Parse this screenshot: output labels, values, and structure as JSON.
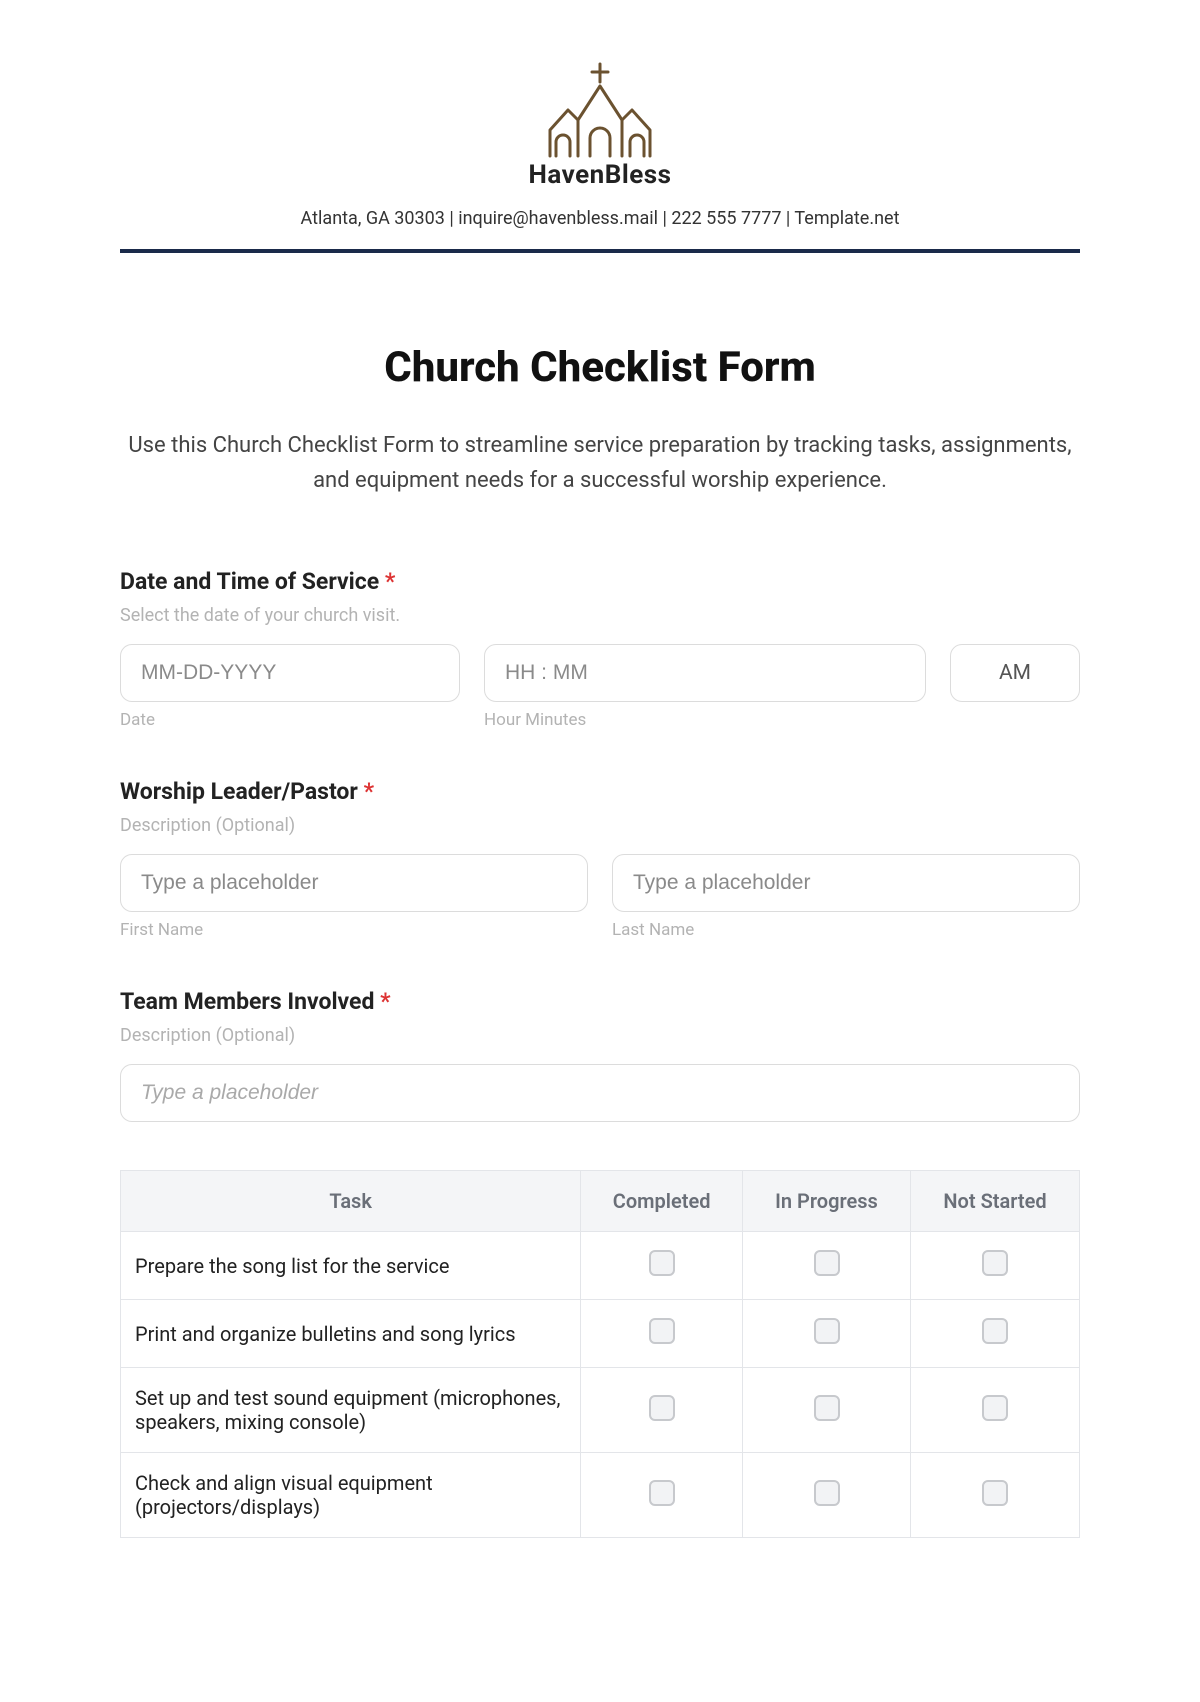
{
  "header": {
    "brand_name": "HavenBless",
    "info_line": "Atlanta, GA 30303 | inquire@havenbless.mail | 222 555 7777 | Template.net"
  },
  "title": "Church Checklist Form",
  "description": "Use this Church Checklist Form to streamline service preparation by tracking tasks, assignments, and equipment needs for a successful worship experience.",
  "fields": {
    "date_time": {
      "label": "Date and Time of Service",
      "required_mark": "*",
      "help": "Select the date of your church visit.",
      "date_placeholder": "MM-DD-YYYY",
      "date_sub": "Date",
      "time_placeholder": "HH : MM",
      "time_sub": "Hour Minutes",
      "ampm": "AM"
    },
    "leader": {
      "label": "Worship Leader/Pastor",
      "required_mark": "*",
      "help": "Description (Optional)",
      "first_placeholder": "Type a placeholder",
      "first_sub": "First Name",
      "last_placeholder": "Type a placeholder",
      "last_sub": "Last Name"
    },
    "team": {
      "label": "Team Members Involved",
      "required_mark": "*",
      "help": "Description (Optional)",
      "placeholder": "Type a placeholder"
    }
  },
  "table": {
    "headers": {
      "task": "Task",
      "completed": "Completed",
      "in_progress": "In Progress",
      "not_started": "Not Started"
    },
    "rows": [
      {
        "task": "Prepare the song list for the service"
      },
      {
        "task": "Print and organize bulletins and song lyrics"
      },
      {
        "task": "Set up and test sound equipment (microphones, speakers, mixing console)"
      },
      {
        "task": "Check and align visual equipment (projectors/displays)"
      }
    ]
  }
}
